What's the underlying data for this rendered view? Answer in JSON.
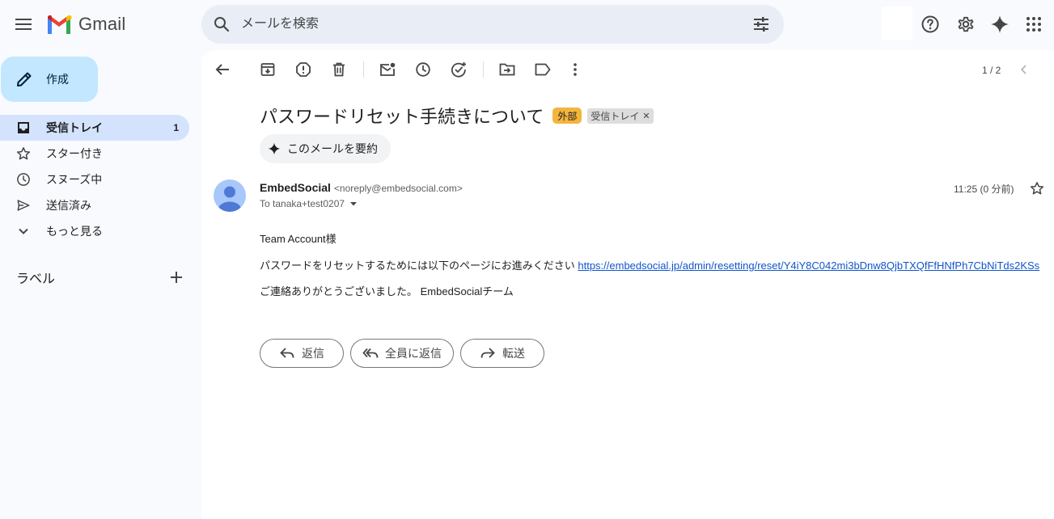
{
  "app": {
    "name": "Gmail"
  },
  "search": {
    "placeholder": "メールを検索"
  },
  "sidebar": {
    "compose_label": "作成",
    "items": [
      {
        "label": "受信トレイ",
        "count": "1"
      },
      {
        "label": "スター付き"
      },
      {
        "label": "スヌーズ中"
      },
      {
        "label": "送信済み"
      },
      {
        "label": "もっと見る"
      }
    ],
    "labels_title": "ラベル"
  },
  "toolbar": {
    "pager": "1 / 2"
  },
  "email": {
    "subject": "パスワードリセット手続きについて",
    "tags": {
      "external": "外部",
      "inbox": "受信トレイ"
    },
    "summarize_label": "このメールを要約",
    "sender_name": "EmbedSocial",
    "sender_email": "<noreply@embedsocial.com>",
    "to": "To tanaka+test0207",
    "time": "11:25 (0 分前)",
    "body": {
      "greeting": "Team Account様",
      "line1_prefix": "パスワードをリセットするためには以下のページにお進みください",
      "link": "https://embedsocial.jp/admin/resetting/reset/Y4iY8C042mi3bDnw8QjbTXQfFfHNfPh7CbNiTds2KSs",
      "closing": "ご連絡ありがとうございました。 EmbedSocialチーム"
    }
  },
  "actions": {
    "reply": "返信",
    "reply_all": "全員に返信",
    "forward": "転送"
  },
  "colors": {
    "accent": "#c2e7ff",
    "active_nav": "#d3e3fd",
    "search_bg": "#e9eef6",
    "external_tag": "#f3b53c",
    "link": "#1155cc"
  },
  "icons": {
    "header": [
      "menu-icon",
      "search-icon",
      "tune-icon",
      "help-icon",
      "settings-icon",
      "gemini-icon",
      "apps-icon"
    ],
    "toolbar": [
      "back-icon",
      "archive-icon",
      "report-spam-icon",
      "delete-icon",
      "mark-unread-icon",
      "snooze-icon",
      "add-task-icon",
      "move-to-icon",
      "label-icon",
      "more-icon",
      "prev-icon"
    ]
  }
}
